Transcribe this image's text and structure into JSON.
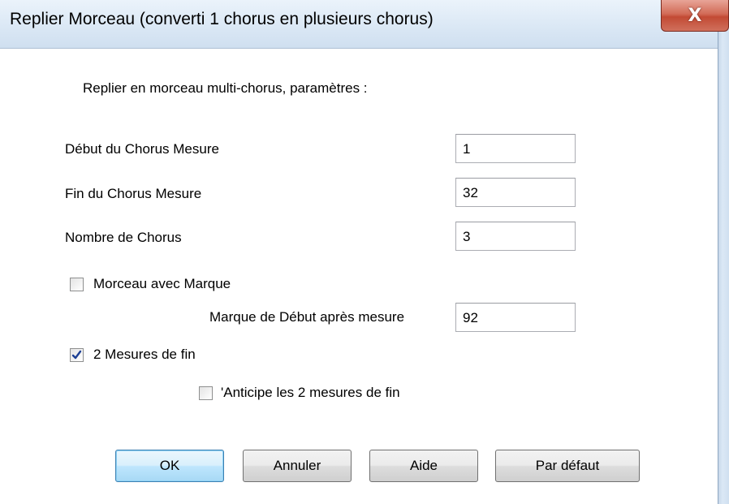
{
  "window": {
    "title": "Replier Morceau (converti 1 chorus en plusieurs chorus)",
    "close_glyph": "X"
  },
  "dialog": {
    "intro": "Replier en morceau multi-chorus, paramètres :",
    "fields": {
      "start_label": "Début du Chorus Mesure",
      "start_value": "1",
      "end_label": "Fin du Chorus Mesure",
      "end_value": "32",
      "count_label": "Nombre de Chorus",
      "count_value": "3",
      "marker_start_label": "Marque de Début après mesure",
      "marker_start_value": "92"
    },
    "checkboxes": {
      "marker_label": "Morceau avec Marque",
      "marker_checked": false,
      "ending_label": "2 Mesures de fin",
      "ending_checked": true,
      "anticipate_label": "'Anticipe les 2 mesures de fin",
      "anticipate_checked": false
    },
    "buttons": {
      "ok": "OK",
      "cancel": "Annuler",
      "help": "Aide",
      "default": "Par défaut"
    }
  },
  "colors": {
    "accent": "#3c7fb1",
    "close": "#c24a34",
    "check": "#1c3f94"
  }
}
